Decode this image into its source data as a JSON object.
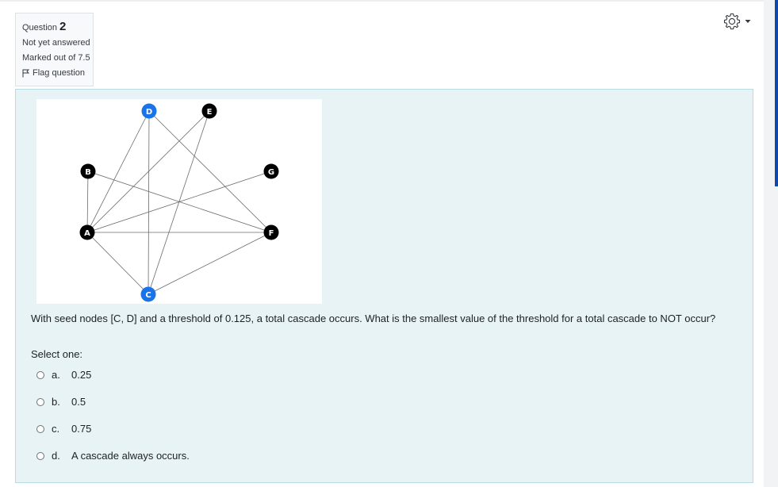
{
  "question_info": {
    "label": "Question",
    "number": "2",
    "state": "Not yet answered",
    "mark": "Marked out of 7.5",
    "flag_label": "Flag question"
  },
  "graph": {
    "nodes": [
      {
        "id": "D",
        "label": "D",
        "color": "#1a73e8"
      },
      {
        "id": "E",
        "label": "E",
        "color": "#000000"
      },
      {
        "id": "B",
        "label": "B",
        "color": "#000000"
      },
      {
        "id": "G",
        "label": "G",
        "color": "#000000"
      },
      {
        "id": "A",
        "label": "A",
        "color": "#000000"
      },
      {
        "id": "F",
        "label": "F",
        "color": "#000000"
      },
      {
        "id": "C",
        "label": "C",
        "color": "#1a73e8"
      }
    ],
    "edges": [
      [
        "A",
        "B"
      ],
      [
        "A",
        "D"
      ],
      [
        "A",
        "E"
      ],
      [
        "A",
        "G"
      ],
      [
        "A",
        "F"
      ],
      [
        "A",
        "C"
      ],
      [
        "B",
        "F"
      ],
      [
        "D",
        "C"
      ],
      [
        "E",
        "C"
      ],
      [
        "C",
        "F"
      ],
      [
        "D",
        "F"
      ]
    ]
  },
  "question_text": "With seed nodes [C, D] and a threshold of 0.125, a total cascade occurs. What is the smallest value of the threshold for a total cascade to NOT occur?",
  "prompt": "Select one:",
  "options": [
    {
      "letter": "a.",
      "text": "0.25"
    },
    {
      "letter": "b.",
      "text": "0.5"
    },
    {
      "letter": "c.",
      "text": "0.75"
    },
    {
      "letter": "d.",
      "text": "A cascade always occurs."
    }
  ]
}
